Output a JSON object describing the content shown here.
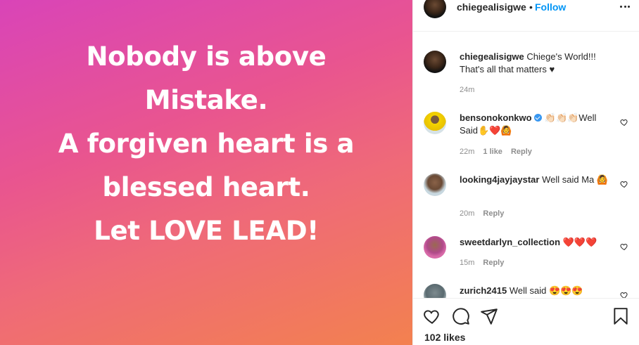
{
  "post": {
    "lines": [
      "Nobody is above",
      "Mistake.",
      "A forgiven heart is a",
      "blessed heart.",
      "Let LOVE LEAD!"
    ],
    "gradient_colors": [
      "#d944b8",
      "#e9558f",
      "#ef6a78",
      "#f3814f"
    ]
  },
  "header": {
    "username": "chiegealisigwe",
    "separator": "•",
    "follow_label": "Follow"
  },
  "caption": {
    "username": "chiegealisigwe",
    "text": "Chiege's World!!! That's all that matters ♥",
    "time": "24m"
  },
  "comments": [
    {
      "username": "bensonokonkwo",
      "verified": true,
      "text": "👏🏻👏🏻👏🏻Well Said✋❤️🙆",
      "time": "22m",
      "likes": "1 like",
      "reply": "Reply"
    },
    {
      "username": "looking4jayjaystar",
      "verified": false,
      "text": "Well said Ma 🙆",
      "time": "20m",
      "likes": "",
      "reply": "Reply"
    },
    {
      "username": "sweetdarlyn_collection",
      "verified": false,
      "text": "❤️❤️❤️",
      "time": "15m",
      "likes": "",
      "reply": "Reply"
    },
    {
      "username": "zurich2415",
      "verified": false,
      "text": "Well said 😍😍😍",
      "time": "",
      "likes": "",
      "reply": ""
    }
  ],
  "actions": {
    "icons": [
      "heart-icon",
      "comment-icon",
      "share-icon",
      "bookmark-icon"
    ]
  },
  "likes_count": "102 likes",
  "colors": {
    "accent": "#0095f6",
    "text": "#262626",
    "muted": "#8e8e8e",
    "border": "#efefef"
  }
}
